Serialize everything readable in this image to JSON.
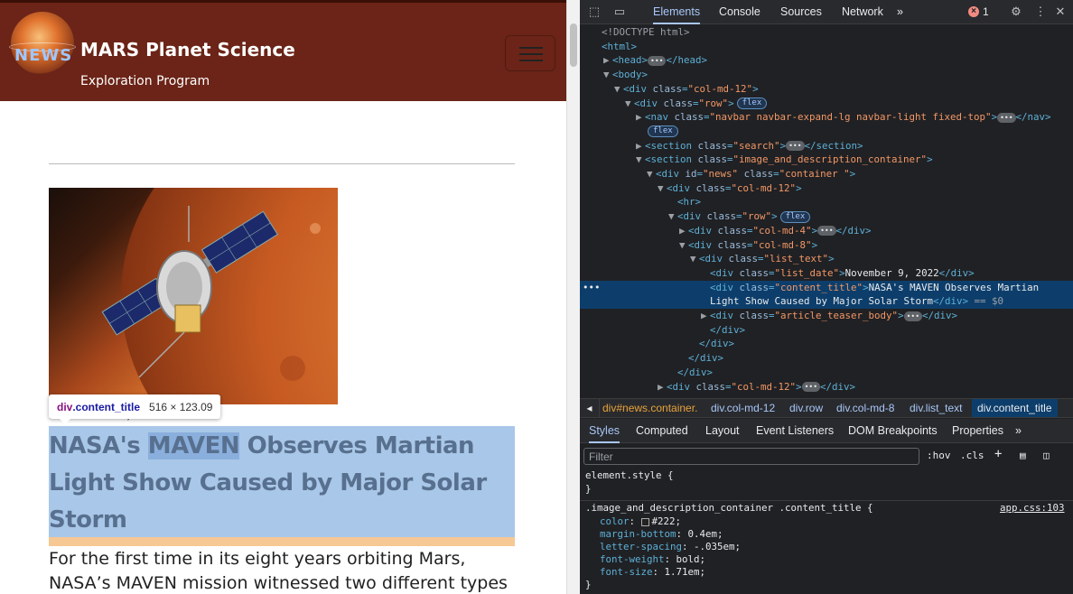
{
  "site": {
    "logo_text": "NEWS",
    "title": "MARS Planet Science",
    "subtitle": "Exploration Program",
    "image_alt": "MAVEN spacecraft orbiting Mars",
    "list_date": "November 9, 2022",
    "content_title_parts": [
      "NASA's ",
      "MAVEN",
      " Observes Martian Light Show Caused by Major Solar Storm"
    ],
    "teaser": "For the first time in its eight years orbiting Mars, NASA’s MAVEN mission witnessed two different types"
  },
  "inspect_tooltip": {
    "tag": "div",
    "class": ".content_title",
    "dimensions": "516 × 123.09"
  },
  "devtools": {
    "tabs": [
      "Elements",
      "Console",
      "Sources",
      "Network"
    ],
    "more_tabs": "»",
    "error_count": "1",
    "dom_lines": [
      {
        "indent": 0,
        "arrow": "",
        "html": "<span class='t-comment'>&lt;!DOCTYPE html&gt;</span>"
      },
      {
        "indent": 0,
        "arrow": "",
        "html": "<span class='t-tag'>&lt;html&gt;</span>"
      },
      {
        "indent": 1,
        "arrow": "▶",
        "html": "<span class='t-tag'>&lt;head&gt;</span><span class='ell'>•••</span><span class='t-tag'>&lt;/head&gt;</span>"
      },
      {
        "indent": 1,
        "arrow": "▼",
        "html": "<span class='t-tag'>&lt;body&gt;</span>"
      },
      {
        "indent": 2,
        "arrow": "▼",
        "html": "<span class='t-tag'>&lt;div </span><span class='t-attr'>class</span><span class='t-tag'>=</span><span class='t-val'>\"col-md-12\"</span><span class='t-tag'>&gt;</span>"
      },
      {
        "indent": 3,
        "arrow": "▼",
        "html": "<span class='t-tag'>&lt;div </span><span class='t-attr'>class</span><span class='t-tag'>=</span><span class='t-val'>\"row\"</span><span class='t-tag'>&gt;</span><span class='badge'>flex</span>"
      },
      {
        "indent": 4,
        "arrow": "▶",
        "html": "<span class='t-tag'>&lt;nav </span><span class='t-attr'>class</span><span class='t-tag'>=</span><span class='t-val'>\"navbar navbar-expand-lg navbar-light fixed-top\"</span><span class='t-tag'>&gt;</span><span class='ell'>•••</span><span class='t-tag'>&lt;/nav&gt;</span>"
      },
      {
        "indent": 4,
        "arrow": "",
        "html": "<span class='badge'>flex</span>"
      },
      {
        "indent": 4,
        "arrow": "▶",
        "html": "<span class='t-tag'>&lt;section </span><span class='t-attr'>class</span><span class='t-tag'>=</span><span class='t-val'>\"search\"</span><span class='t-tag'>&gt;</span><span class='ell'>•••</span><span class='t-tag'>&lt;/section&gt;</span>"
      },
      {
        "indent": 4,
        "arrow": "▼",
        "html": "<span class='t-tag'>&lt;section </span><span class='t-attr'>class</span><span class='t-tag'>=</span><span class='t-val'>\"image_and_description_container\"</span><span class='t-tag'>&gt;</span>"
      },
      {
        "indent": 5,
        "arrow": "▼",
        "html": "<span class='t-tag'>&lt;div </span><span class='t-attr'>id</span><span class='t-tag'>=</span><span class='t-val'>\"news\"</span><span class='t-attr'> class</span><span class='t-tag'>=</span><span class='t-val'>\"container \"</span><span class='t-tag'>&gt;</span>"
      },
      {
        "indent": 6,
        "arrow": "▼",
        "html": "<span class='t-tag'>&lt;div </span><span class='t-attr'>class</span><span class='t-tag'>=</span><span class='t-val'>\"col-md-12\"</span><span class='t-tag'>&gt;</span>"
      },
      {
        "indent": 7,
        "arrow": "",
        "html": "<span class='t-tag'>&lt;hr&gt;</span>"
      },
      {
        "indent": 7,
        "arrow": "▼",
        "html": "<span class='t-tag'>&lt;div </span><span class='t-attr'>class</span><span class='t-tag'>=</span><span class='t-val'>\"row\"</span><span class='t-tag'>&gt;</span><span class='badge'>flex</span>"
      },
      {
        "indent": 8,
        "arrow": "▶",
        "html": "<span class='t-tag'>&lt;div </span><span class='t-attr'>class</span><span class='t-tag'>=</span><span class='t-val'>\"col-md-4\"</span><span class='t-tag'>&gt;</span><span class='ell'>•••</span><span class='t-tag'>&lt;/div&gt;</span>"
      },
      {
        "indent": 8,
        "arrow": "▼",
        "html": "<span class='t-tag'>&lt;div </span><span class='t-attr'>class</span><span class='t-tag'>=</span><span class='t-val'>\"col-md-8\"</span><span class='t-tag'>&gt;</span>"
      },
      {
        "indent": 9,
        "arrow": "▼",
        "html": "<span class='t-tag'>&lt;div </span><span class='t-attr'>class</span><span class='t-tag'>=</span><span class='t-val'>\"list_text\"</span><span class='t-tag'>&gt;</span>"
      },
      {
        "indent": 10,
        "arrow": "",
        "html": "<span class='t-tag'>&lt;div </span><span class='t-attr'>class</span><span class='t-tag'>=</span><span class='t-val'>\"list_date\"</span><span class='t-tag'>&gt;</span><span class='t-txt'>November 9, 2022</span><span class='t-tag'>&lt;/div&gt;</span>"
      },
      {
        "indent": 10,
        "arrow": "",
        "selected": true,
        "html": "<span class='t-tag'>&lt;div </span><span class='t-attr'>class</span><span class='t-tag'>=</span><span class='t-val'>\"content_title\"</span><span class='t-tag'>&gt;</span><span class='t-txt'>NASA's MAVEN Observes Martian</span>"
      },
      {
        "indent": 10,
        "arrow": "",
        "selected": true,
        "html": "<span class='t-txt'>Light Show Caused by Major Solar Storm</span><span class='t-tag'>&lt;/div&gt;</span><span class='t-comment'> == $0</span>"
      },
      {
        "indent": 10,
        "arrow": "▶",
        "html": "<span class='t-tag'>&lt;div </span><span class='t-attr'>class</span><span class='t-tag'>=</span><span class='t-val'>\"article_teaser_body\"</span><span class='t-tag'>&gt;</span><span class='ell'>•••</span><span class='t-tag'>&lt;/div&gt;</span>"
      },
      {
        "indent": 10,
        "arrow": "",
        "html": "<span class='t-tag'>&lt;/div&gt;</span>"
      },
      {
        "indent": 9,
        "arrow": "",
        "html": "<span class='t-tag'>&lt;/div&gt;</span>"
      },
      {
        "indent": 8,
        "arrow": "",
        "html": "<span class='t-tag'>&lt;/div&gt;</span>"
      },
      {
        "indent": 7,
        "arrow": "",
        "html": "<span class='t-tag'>&lt;/div&gt;</span>"
      },
      {
        "indent": 6,
        "arrow": "▶",
        "html": "<span class='t-tag'>&lt;div </span><span class='t-attr'>class</span><span class='t-tag'>=</span><span class='t-val'>\"col-md-12\"</span><span class='t-tag'>&gt;</span><span class='ell'>•••</span><span class='t-tag'>&lt;/div&gt;</span>"
      }
    ],
    "selected_marker": "•••",
    "breadcrumbs": [
      "div#news.container.",
      "div.col-md-12",
      "div.row",
      "div.col-md-8",
      "div.list_text",
      "div.content_title"
    ],
    "sub_tabs": [
      "Styles",
      "Computed",
      "Layout",
      "Event Listeners",
      "DOM Breakpoints",
      "Properties"
    ],
    "filter_placeholder": "Filter",
    "filter_hov": ":hov",
    "filter_cls": ".cls",
    "styles": {
      "element_style": "element.style {",
      "close_brace": "}",
      "rule_selector": ".image_and_description_container .content_title {",
      "rule_source": "app.css:103",
      "props": [
        {
          "name": "color",
          "value": "#222;",
          "swatch": true
        },
        {
          "name": "margin-bottom",
          "value": "0.4em;"
        },
        {
          "name": "letter-spacing",
          "value": "-.035em;"
        },
        {
          "name": "font-weight",
          "value": "bold;"
        },
        {
          "name": "font-size",
          "value": "1.71em;"
        }
      ]
    }
  },
  "colors": {
    "header_bg": "#6b2417",
    "highlight": "#a9c7e8",
    "devtools_bg": "#202124",
    "accent": "#a8c7fa"
  }
}
